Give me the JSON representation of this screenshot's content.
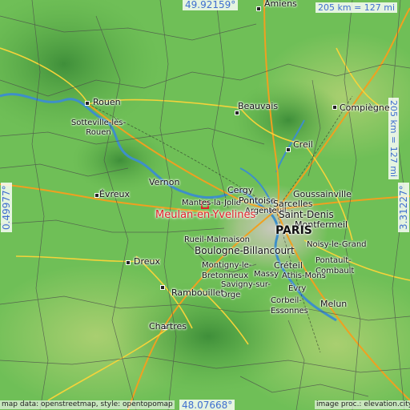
{
  "map": {
    "cities": [
      {
        "name": "Amiens"
      },
      {
        "name": "Rouen"
      },
      {
        "name": "Sotteville-lès-Rouen"
      },
      {
        "name": "Beauvais"
      },
      {
        "name": "Compiègne"
      },
      {
        "name": "Creil"
      },
      {
        "name": "Vernon"
      },
      {
        "name": "Évreux"
      },
      {
        "name": "Mantes-la-Jolie"
      },
      {
        "name": "Cergy"
      },
      {
        "name": "Pontoise"
      },
      {
        "name": "Sarcelles"
      },
      {
        "name": "Argenteuil"
      },
      {
        "name": "Goussainville"
      },
      {
        "name": "Saint-Denis"
      },
      {
        "name": "Montfermeil"
      },
      {
        "name": "PARIS"
      },
      {
        "name": "Rueil-Malmaison"
      },
      {
        "name": "Boulogne-Billancourt"
      },
      {
        "name": "Noisy-le-Grand"
      },
      {
        "name": "Dreux"
      },
      {
        "name": "Créteil"
      },
      {
        "name": "Montigny-le-Bretonneux"
      },
      {
        "name": "Massy"
      },
      {
        "name": "Pontault-Combault"
      },
      {
        "name": "Savigny-sur-Orge"
      },
      {
        "name": "Athis-Mons"
      },
      {
        "name": "Évry"
      },
      {
        "name": "Rambouillet"
      },
      {
        "name": "Corbeil-Essonnes"
      },
      {
        "name": "Melun"
      },
      {
        "name": "Chartres"
      }
    ],
    "highlight": {
      "name": "Meulan-en-Yvelines"
    },
    "coordinates": {
      "top": "49.92159°",
      "bottom": "48.07668°",
      "left": "0.49977°",
      "right": "3.31227°"
    },
    "scale": {
      "horizontal": "205 km = 127 mi",
      "vertical": "205 km = 127 mi"
    },
    "attribution": {
      "left": "map data: openstreetmap, style: opentopomap",
      "right": "image proc.: elevation.city"
    },
    "colors": {
      "coordinate_text": "#3f6fd0",
      "highlight": "#e0202a"
    }
  }
}
